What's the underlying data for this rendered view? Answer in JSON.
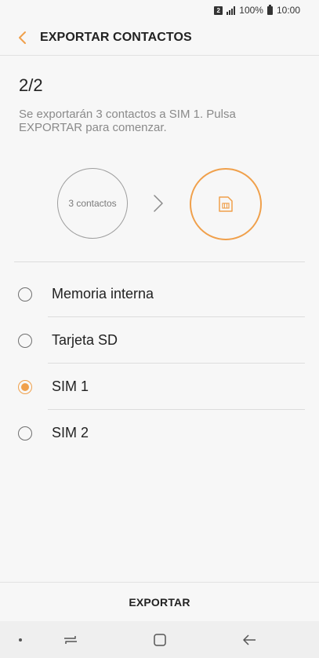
{
  "status_bar": {
    "sim_badge": "2",
    "battery_percent": "100%",
    "time": "10:00"
  },
  "header": {
    "title": "EXPORTAR CONTACTOS",
    "back_icon": "chevron-left-icon"
  },
  "step": {
    "counter": "2/2",
    "description": "Se exportarán 3 contactos a SIM 1. Pulsa EXPORTAR para comenzar."
  },
  "illustration": {
    "source_label": "3 contactos",
    "arrow_icon": "chevron-right-icon",
    "target_icon": "sim-card-icon"
  },
  "options": [
    {
      "label": "Memoria interna",
      "selected": false
    },
    {
      "label": "Tarjeta SD",
      "selected": false
    },
    {
      "label": "SIM 1",
      "selected": true
    },
    {
      "label": "SIM 2",
      "selected": false
    }
  ],
  "footer": {
    "export_label": "EXPORTAR"
  },
  "colors": {
    "accent": "#f0a04b",
    "text_primary": "#222222",
    "text_secondary": "#8a8a8a",
    "background": "#f7f7f7"
  }
}
